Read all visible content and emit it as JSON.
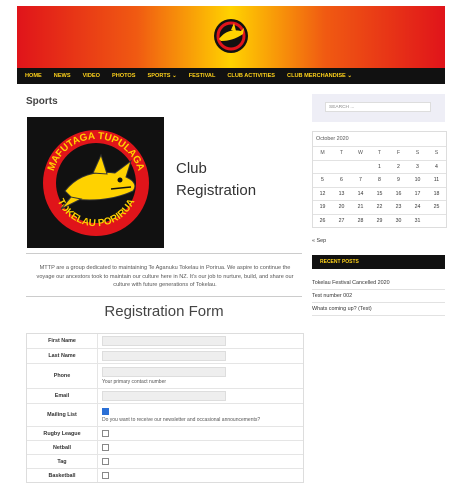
{
  "nav": {
    "items": [
      "HOME",
      "NEWS",
      "VIDEO",
      "PHOTOS",
      "SPORTS ⌄",
      "FESTIVAL",
      "CLUB ACTIVITIES",
      "CLUB MERCHANDISE ⌄"
    ]
  },
  "page": {
    "title": "Sports",
    "club_line1": "Club",
    "club_line2": "Registration"
  },
  "intro": "MTTP are a group dedicated to maintaining Te Aganuku Tokelau in Porirua. We aspire to continue the voyage our ancestors took to maintain our culture here in NZ. It's our job to nurture, build, and share our culture with future generations of Tokelau.",
  "form": {
    "title": "Registration Form",
    "first_name": "First Name",
    "last_name": "Last Name",
    "phone": "Phone",
    "phone_help": "Your primary contact number",
    "email": "Email",
    "mailing_list": "Mailing List",
    "mailing_help": "Do you want to receive our newsletter and occasional announcements?",
    "mailing_checked": true,
    "sports": [
      "Rugby League",
      "Netball",
      "Tag",
      "Basketball"
    ]
  },
  "sidebar": {
    "search_placeholder": "SEARCH ...",
    "calendar": {
      "caption": "October 2020",
      "days": [
        "M",
        "T",
        "W",
        "T",
        "F",
        "S",
        "S"
      ],
      "weeks": [
        [
          "",
          "",
          "",
          "1",
          "2",
          "3",
          "4"
        ],
        [
          "5",
          "6",
          "7",
          "8",
          "9",
          "10",
          "11"
        ],
        [
          "12",
          "13",
          "14",
          "15",
          "16",
          "17",
          "18"
        ],
        [
          "19",
          "20",
          "21",
          "22",
          "23",
          "24",
          "25"
        ],
        [
          "26",
          "27",
          "28",
          "29",
          "30",
          "31",
          ""
        ]
      ]
    },
    "prev_link": "« Sep",
    "recent_posts_title": "RECENT POSTS",
    "recent_posts": [
      "Tokelau Festival Cancelled 2020",
      "Test number 002",
      "Whats coming up? (Test)"
    ]
  },
  "logo": {
    "top_text": "MAFUTAGA TUPULAGA",
    "bottom_text": "TOKELAU PORIRUA"
  },
  "colors": {
    "nav_bg": "#111111",
    "nav_text": "#ffd21a",
    "accent": "#2a6fd6"
  }
}
